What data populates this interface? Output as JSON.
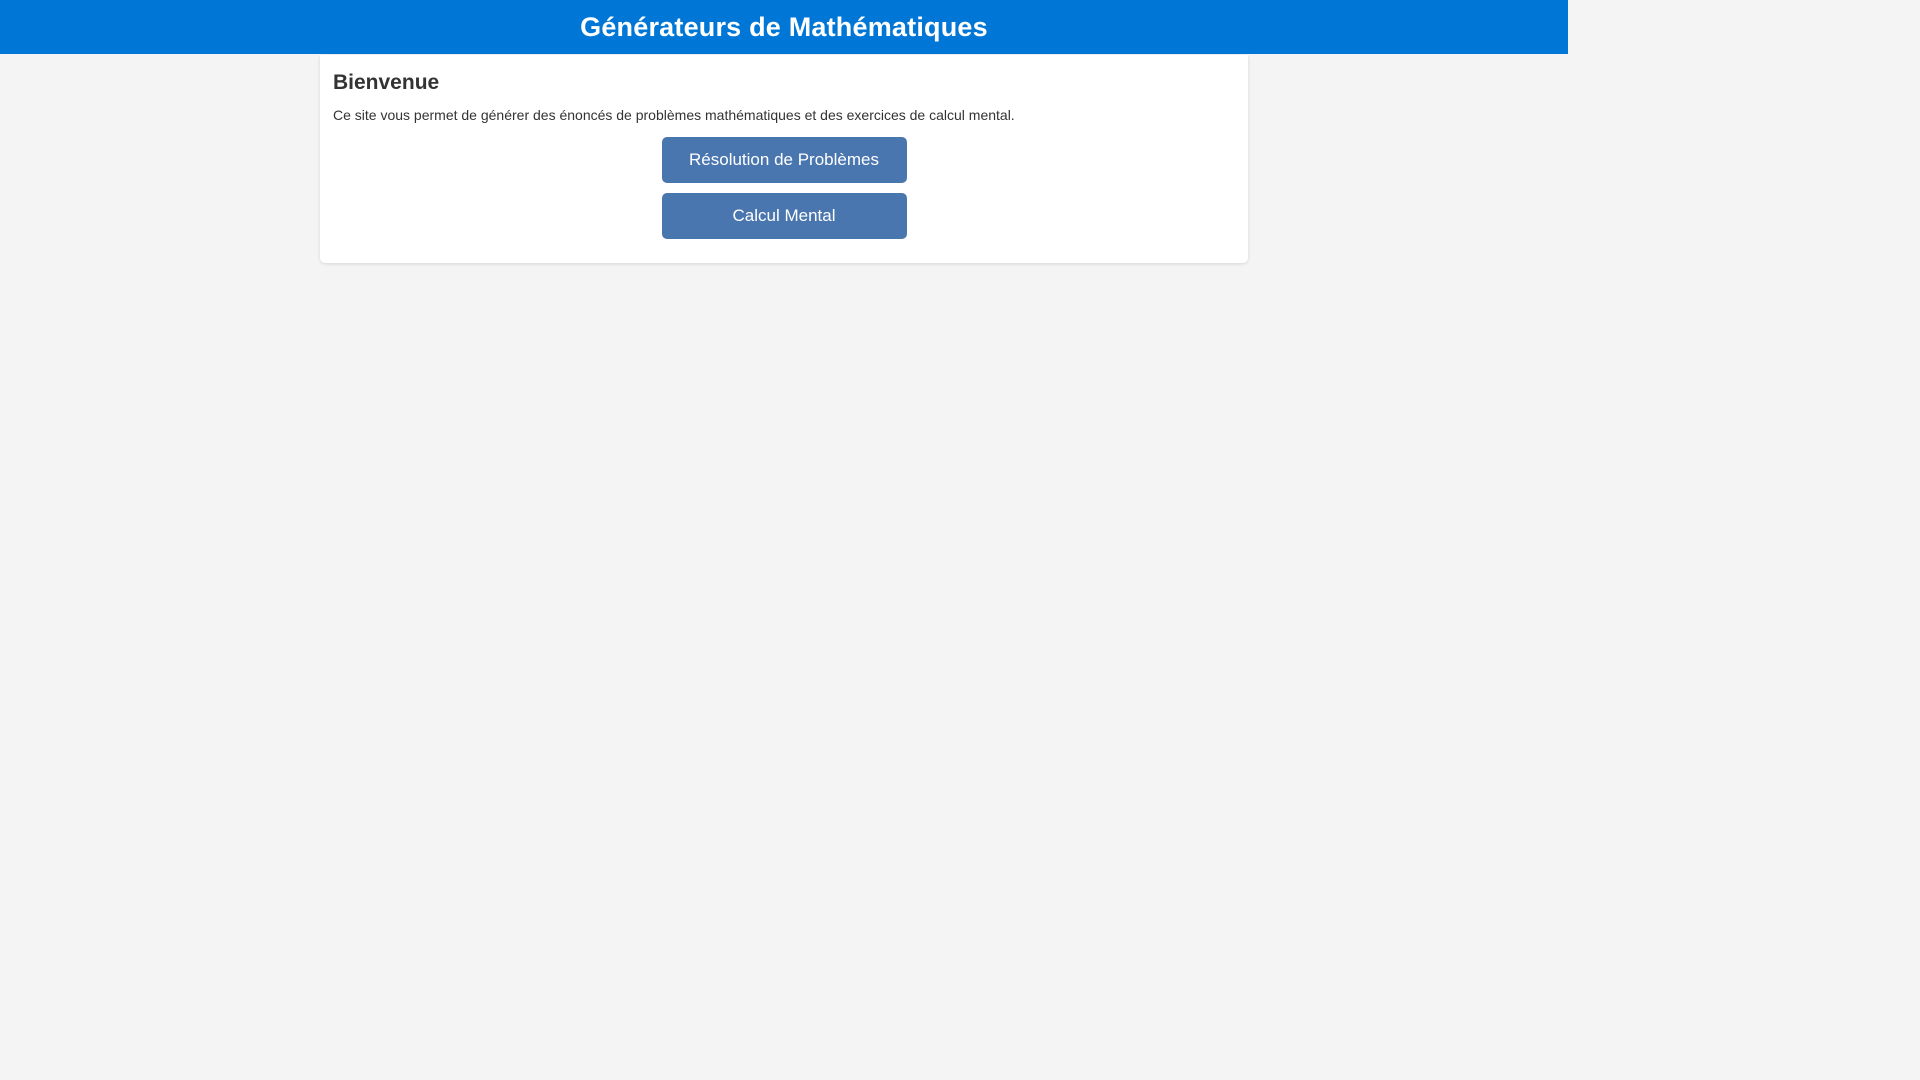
{
  "header": {
    "title": "Générateurs de Mathématiques"
  },
  "main": {
    "heading": "Bienvenue",
    "description": "Ce site vous permet de générer des énoncés de problèmes mathématiques et des exercices de calcul mental.",
    "buttons": [
      {
        "label": "Résolution de Problèmes"
      },
      {
        "label": "Calcul Mental"
      }
    ]
  },
  "colors": {
    "header_background": "#0077d6",
    "button_background": "#4a76b0",
    "page_background": "#f4f4f4",
    "card_background": "#ffffff"
  }
}
